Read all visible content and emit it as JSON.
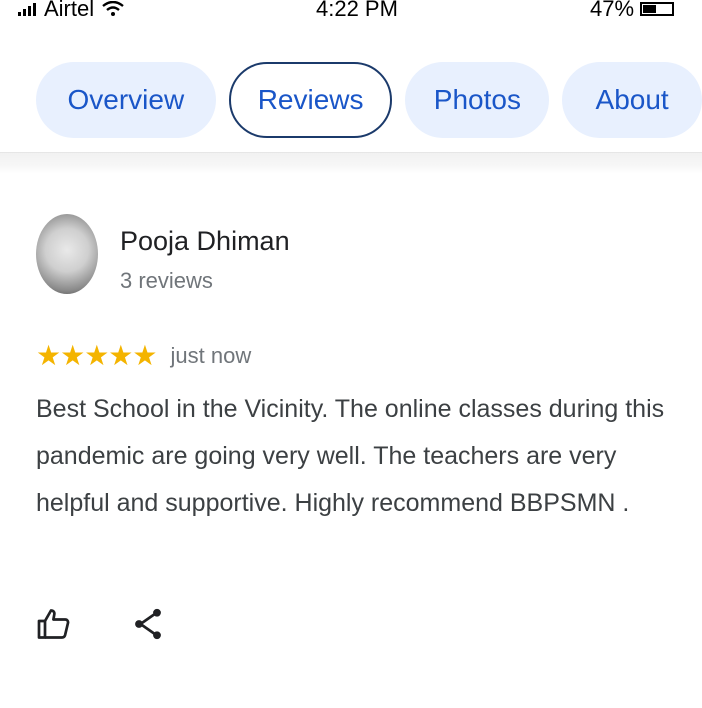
{
  "status_bar": {
    "carrier": "Airtel",
    "time": "4:22 PM",
    "battery": "47%",
    "battery_level": 0.47,
    "icons": [
      "signal-icon",
      "wifi-icon",
      "battery-icon"
    ]
  },
  "tabs": [
    {
      "label": "Overview",
      "active": false
    },
    {
      "label": "Reviews",
      "active": true
    },
    {
      "label": "Photos",
      "active": false
    },
    {
      "label": "About",
      "active": false
    }
  ],
  "review": {
    "reviewer_name": "Pooja Dhiman",
    "reviewer_count": "3 reviews",
    "rating": 5,
    "stars": "★★★★★",
    "time": "just now",
    "text": "Best School in the Vicinity. The online classes during this pandemic are going very well. The teachers are very helpful and supportive. Highly recommend BBPSMN .",
    "actions": [
      "thumbs-up-icon",
      "share-icon"
    ]
  },
  "colors": {
    "tab_bg": "#e8f0fe",
    "tab_text": "#1a56c8",
    "active_tab_border": "#1b3a6b",
    "star": "#f4b400",
    "secondary_text": "#70757a",
    "body_text": "#3c4043"
  }
}
